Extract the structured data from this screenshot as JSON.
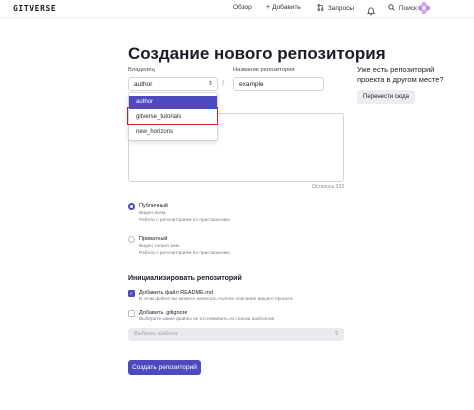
{
  "header": {
    "logo": "GITVERSE",
    "nav": [
      {
        "icon": "",
        "label": "Обзор"
      },
      {
        "icon": "plus-icon",
        "label": "Добавить"
      },
      {
        "icon": "pull-request-icon",
        "label": "Запросы"
      }
    ],
    "search_label": "Поиск",
    "bell_icon": "bell-icon",
    "avatar_icon": "flower-avatar-icon"
  },
  "page": {
    "title": "Создание нового репозитория"
  },
  "form": {
    "owner_label": "Владелец",
    "owner_value": "author",
    "owner_options": [
      "author",
      "gitverse_tutorials",
      "new_horizons"
    ],
    "highlighted_option": "gitverse_tutorials",
    "separator": "/",
    "name_label": "Название репозитория",
    "name_value": "example",
    "description_counter": "Осталось 333",
    "visibility": {
      "public_title": "Публичный",
      "public_sub1": "Виден всем.",
      "public_sub2": "Работа с репозиторием по приглашению.",
      "public_selected": true,
      "private_title": "Приватный",
      "private_sub1": "Виден только вам.",
      "private_sub2": "Работа с репозиторием по приглашению.",
      "private_selected": false
    },
    "init_title": "Инициализировать репозиторий",
    "readme_title": "Добавить файл README.md",
    "readme_sub": "В этом файле вы можете написать полное описание вашего проекта",
    "readme_checked": true,
    "gitignore_title": "Добавить .gitignore",
    "gitignore_sub": "Выберите какие файлы не отслеживать из списка шаблонов",
    "gitignore_checked": false,
    "template_placeholder": "Выбрать шаблон",
    "submit_label": "Создать репозиторий"
  },
  "sidebar": {
    "question": "Уже есть репозиторий проекта в другом месте?",
    "import_label": "Перенести сюда"
  },
  "colors": {
    "accent": "#4b4bbf",
    "highlight_outline": "#d62020"
  }
}
